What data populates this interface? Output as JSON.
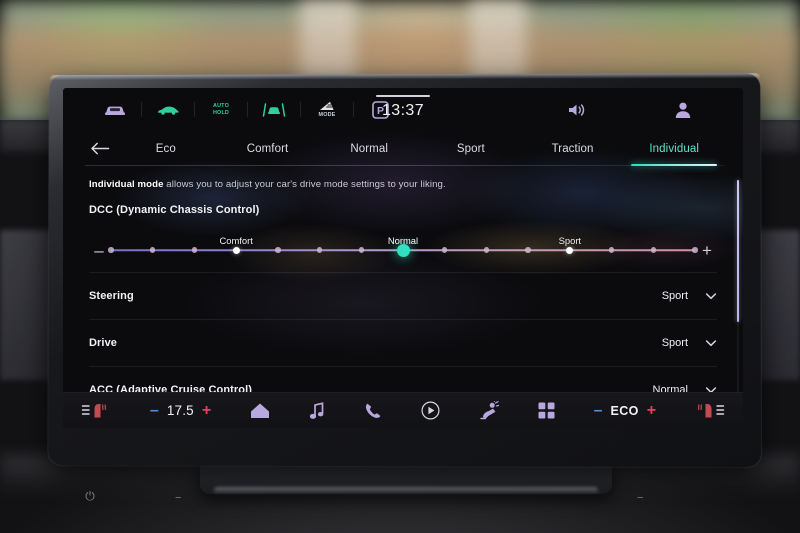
{
  "statusbar": {
    "icons": [
      {
        "name": "car-front-icon",
        "label": "",
        "color": "#b9a8dd"
      },
      {
        "name": "car-side-eco-icon",
        "label": "",
        "color": "#2fcf9e"
      },
      {
        "name": "auto-hold-icon",
        "label": "AUTO\nHOLD",
        "color": "#2fcf9e"
      },
      {
        "name": "lane-assist-icon",
        "label": "",
        "color": "#2fcf9e"
      },
      {
        "name": "drive-mode-icon",
        "label": "MODE",
        "color": "#cfd2dc"
      },
      {
        "name": "park-brake-icon",
        "label": "P",
        "color": "#b9a8dd"
      }
    ],
    "clock": "13:37",
    "volume_icon": "volume-icon",
    "profile_icon": "user-profile-icon"
  },
  "tabbar": {
    "back_label": "back",
    "tabs": [
      {
        "label": "Eco",
        "active": false
      },
      {
        "label": "Comfort",
        "active": false
      },
      {
        "label": "Normal",
        "active": false
      },
      {
        "label": "Sport",
        "active": false
      },
      {
        "label": "Traction",
        "active": false
      },
      {
        "label": "Individual",
        "active": true
      }
    ]
  },
  "content": {
    "description_bold": "Individual mode",
    "description_rest": " allows you to adjust your car's drive mode settings to your liking.",
    "dcc": {
      "title": "DCC (Dynamic Chassis Control)",
      "minus_label": "–",
      "plus_label": "+",
      "tick_count": 15,
      "current_index": 7,
      "labels": [
        {
          "text": "Comfort",
          "index": 3
        },
        {
          "text": "Normal",
          "index": 7
        },
        {
          "text": "Sport",
          "index": 11
        }
      ]
    },
    "rows": [
      {
        "label": "Steering",
        "value": "Sport"
      },
      {
        "label": "Drive",
        "value": "Sport"
      },
      {
        "label": "ACC (Adaptive Cruise Control)",
        "value": "Normal"
      }
    ]
  },
  "dock": {
    "left_seat_icon": "left-seat-heating-icon",
    "temp_minus": "–",
    "temperature": "17.5",
    "temp_plus": "+",
    "home_icon": "home-icon",
    "media_icon": "music-note-icon",
    "phone_icon": "phone-icon",
    "play_icon": "play-circle-icon",
    "assist_icon": "car-assist-icon",
    "apps_icon": "apps-grid-icon",
    "eco_minus": "–",
    "eco_label": "ECO",
    "eco_plus": "+",
    "right_seat_icon": "right-seat-heating-icon"
  },
  "colors": {
    "accent_teal": "#31e0c0",
    "accent_purple": "#b9a8dd",
    "accent_green": "#2fcf9e",
    "temp_minus_blue": "#4a90e2",
    "temp_plus_red": "#e8415a"
  }
}
